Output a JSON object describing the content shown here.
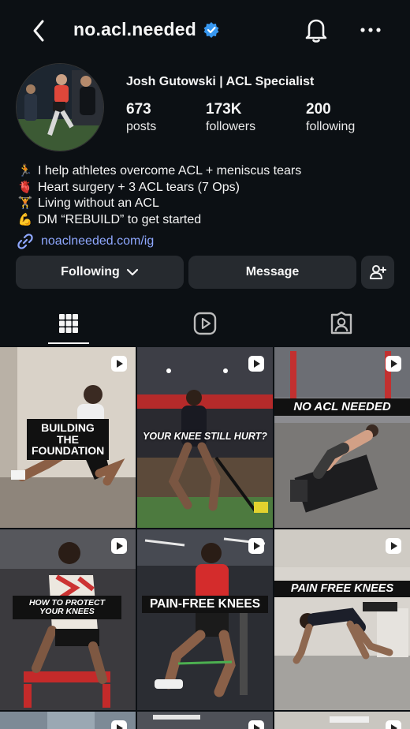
{
  "header": {
    "username": "no.acl.needed",
    "verified": true,
    "back_icon": "chevron-left-icon",
    "bell_icon": "bell-icon",
    "more_icon": "more-horizontal-icon"
  },
  "profile": {
    "display_name": "Josh Gutowski | ACL Specialist",
    "stats": [
      {
        "value": "673",
        "label": "posts"
      },
      {
        "value": "173K",
        "label": "followers"
      },
      {
        "value": "200",
        "label": "following"
      }
    ],
    "bio": [
      {
        "emoji": "🏃",
        "text": "I help athletes overcome ACL + meniscus tears"
      },
      {
        "emoji": "🫀",
        "text": "Heart surgery + 3 ACL tears (7 Ops)"
      },
      {
        "emoji": "🏋",
        "text": "Living without an ACL"
      },
      {
        "emoji": "💪",
        "text": "DM “REBUILD” to get started"
      }
    ],
    "link": "noaclneeded.com/ig"
  },
  "actions": {
    "following_label": "Following",
    "message_label": "Message"
  },
  "tabs": [
    "grid-icon",
    "reels-icon",
    "tagged-icon"
  ],
  "posts": [
    {
      "caption": "BUILDING THE FOUNDATION"
    },
    {
      "caption": "YOUR KNEE STILL HURT?"
    },
    {
      "caption": "NO ACL NEEDED"
    },
    {
      "caption": "HOW TO PROTECT YOUR KNEES"
    },
    {
      "caption": "PAIN-FREE KNEES"
    },
    {
      "caption": "PAIN FREE KNEES"
    }
  ],
  "colors": {
    "background": "#0c1014",
    "button": "#262a2f",
    "link": "#8fa8ff",
    "verified": "#3797f0"
  }
}
